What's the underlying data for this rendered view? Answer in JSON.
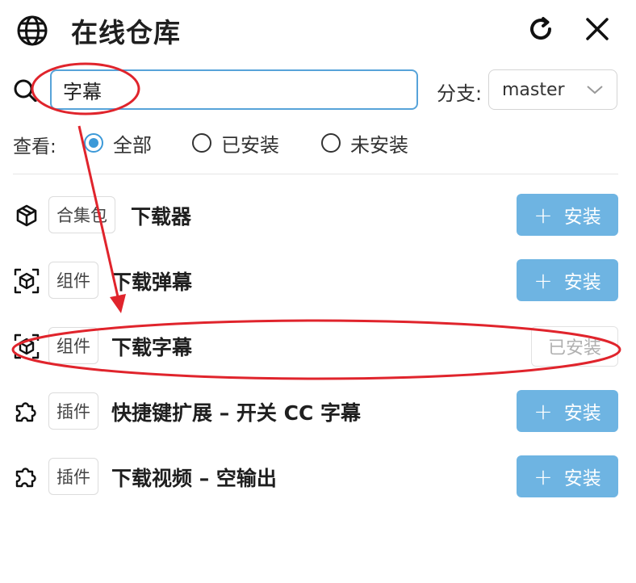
{
  "header": {
    "title": "在线仓库",
    "icons": {
      "globe": "globe-icon",
      "refresh": "refresh-icon",
      "close": "close-icon"
    }
  },
  "search": {
    "value": "字幕",
    "placeholder": ""
  },
  "branch": {
    "label": "分支:",
    "selected": "master"
  },
  "filter": {
    "label": "查看:",
    "options": [
      {
        "label": "全部",
        "selected": true
      },
      {
        "label": "已安装",
        "selected": false
      },
      {
        "label": "未安装",
        "selected": false
      }
    ]
  },
  "items": [
    {
      "icon": "package-icon",
      "tag": "合集包",
      "name": "下载器",
      "action": "安装",
      "installed": false
    },
    {
      "icon": "component-icon",
      "tag": "组件",
      "name": "下载弹幕",
      "action": "安装",
      "installed": false
    },
    {
      "icon": "component-icon",
      "tag": "组件",
      "name": "下载字幕",
      "action": "已安装",
      "installed": true
    },
    {
      "icon": "plugin-icon",
      "tag": "插件",
      "name": "快捷键扩展 – 开关 CC 字幕",
      "action": "安装",
      "installed": false
    },
    {
      "icon": "plugin-icon",
      "tag": "插件",
      "name": "下载视频 – 空输出",
      "action": "安装",
      "installed": false
    }
  ],
  "colors": {
    "accent": "#3c99d8",
    "install_button": "#6eb4e2",
    "annotation": "#e0242c"
  }
}
